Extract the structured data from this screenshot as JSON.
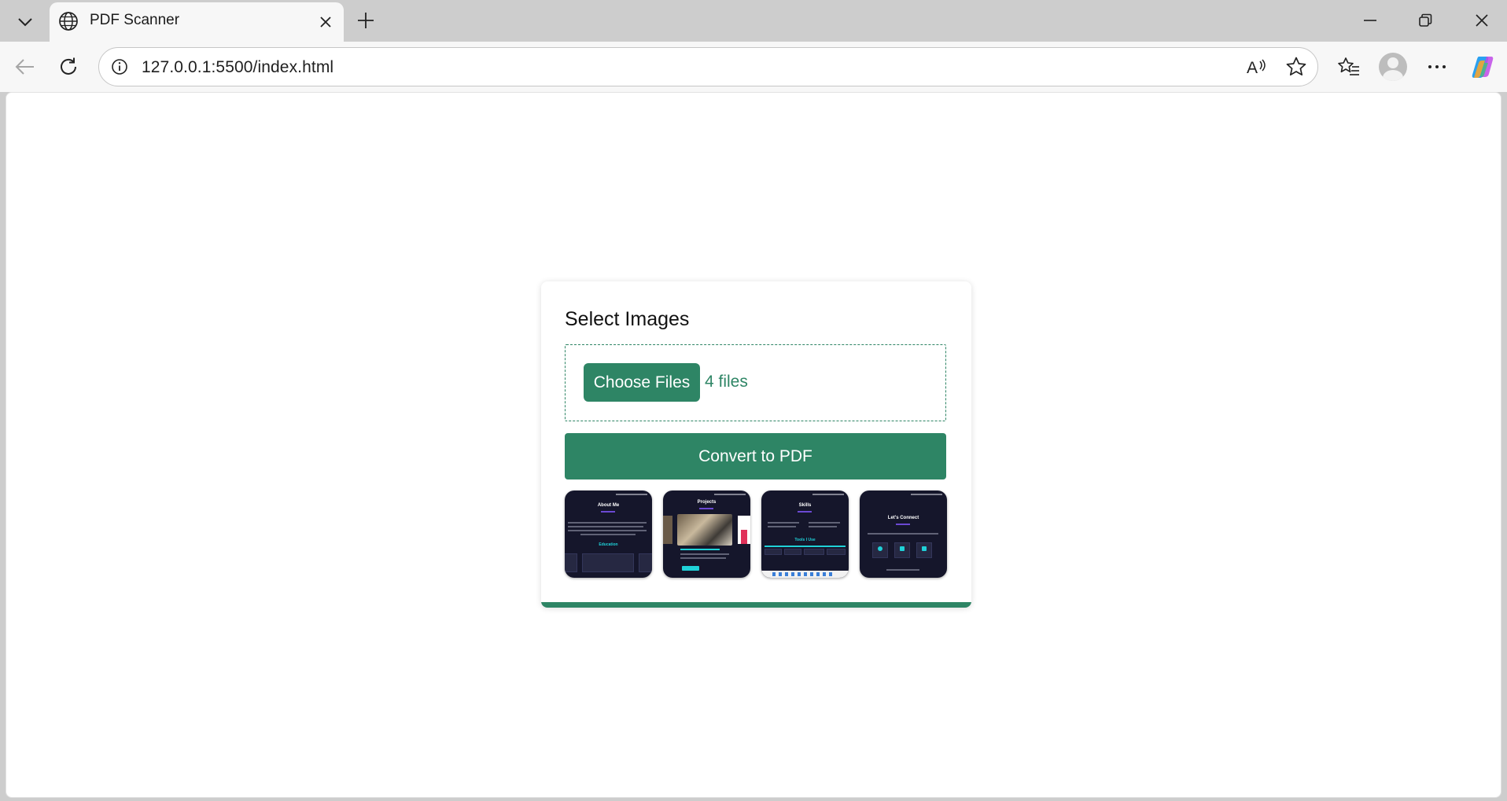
{
  "browser": {
    "tab_title": "PDF Scanner",
    "url": "127.0.0.1:5500/index.html",
    "icons": [
      "tab-list-icon",
      "globe-icon",
      "close-icon",
      "plus-icon",
      "minimize-icon",
      "restore-icon",
      "window-close-icon",
      "back-arrow-icon",
      "reload-icon",
      "info-icon",
      "read-aloud-icon",
      "star-icon",
      "favorites-icon",
      "avatar-icon",
      "more-icon",
      "copilot-icon"
    ]
  },
  "card": {
    "title": "Select Images",
    "choose_files_label": "Choose Files",
    "file_count": "4 files",
    "convert_label": "Convert to PDF",
    "thumbnails": [
      {
        "title": "About Me",
        "subtitle": "Education"
      },
      {
        "title": "Projects",
        "subtitle": ""
      },
      {
        "title": "Skills",
        "subtitle": "Tools I Use"
      },
      {
        "title": "Let's Connect",
        "subtitle": ""
      }
    ]
  },
  "colors": {
    "accent": "#2e8565",
    "thumb_bg": "#15162b",
    "thumb_cyan": "#1fd1d8"
  }
}
